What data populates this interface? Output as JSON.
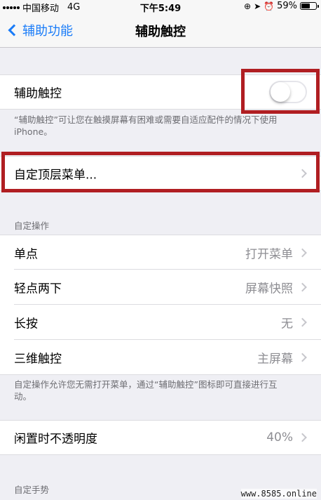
{
  "status_bar": {
    "carrier": "中国移动",
    "network": "4G",
    "time": "下午5:49",
    "battery": "59%",
    "battery_level": 0.59
  },
  "nav": {
    "back_label": "辅助功能",
    "title": "辅助触控"
  },
  "assistive_touch": {
    "label": "辅助触控",
    "enabled": false,
    "note": "“辅助触控”可让您在触摸屏幕有困难或需要自适应配件的情况下使用 iPhone。"
  },
  "customize_menu": {
    "label": "自定顶层菜单..."
  },
  "custom_actions": {
    "header": "自定操作",
    "rows": [
      {
        "label": "单点",
        "value": "打开菜单"
      },
      {
        "label": "轻点两下",
        "value": "屏幕快照"
      },
      {
        "label": "长按",
        "value": "无"
      },
      {
        "label": "三维触控",
        "value": "主屏幕"
      }
    ],
    "note": "自定操作允许您无需打开菜单，通过“辅助触控”图标即可直接进行互动。"
  },
  "idle_opacity": {
    "label": "闲置时不透明度",
    "value": "40%"
  },
  "custom_gestures": {
    "header": "自定手势"
  },
  "watermark": "www.8585.online",
  "colors": {
    "accent": "#1a7cf8",
    "highlight": "#b01e22",
    "background": "#efeff4"
  }
}
